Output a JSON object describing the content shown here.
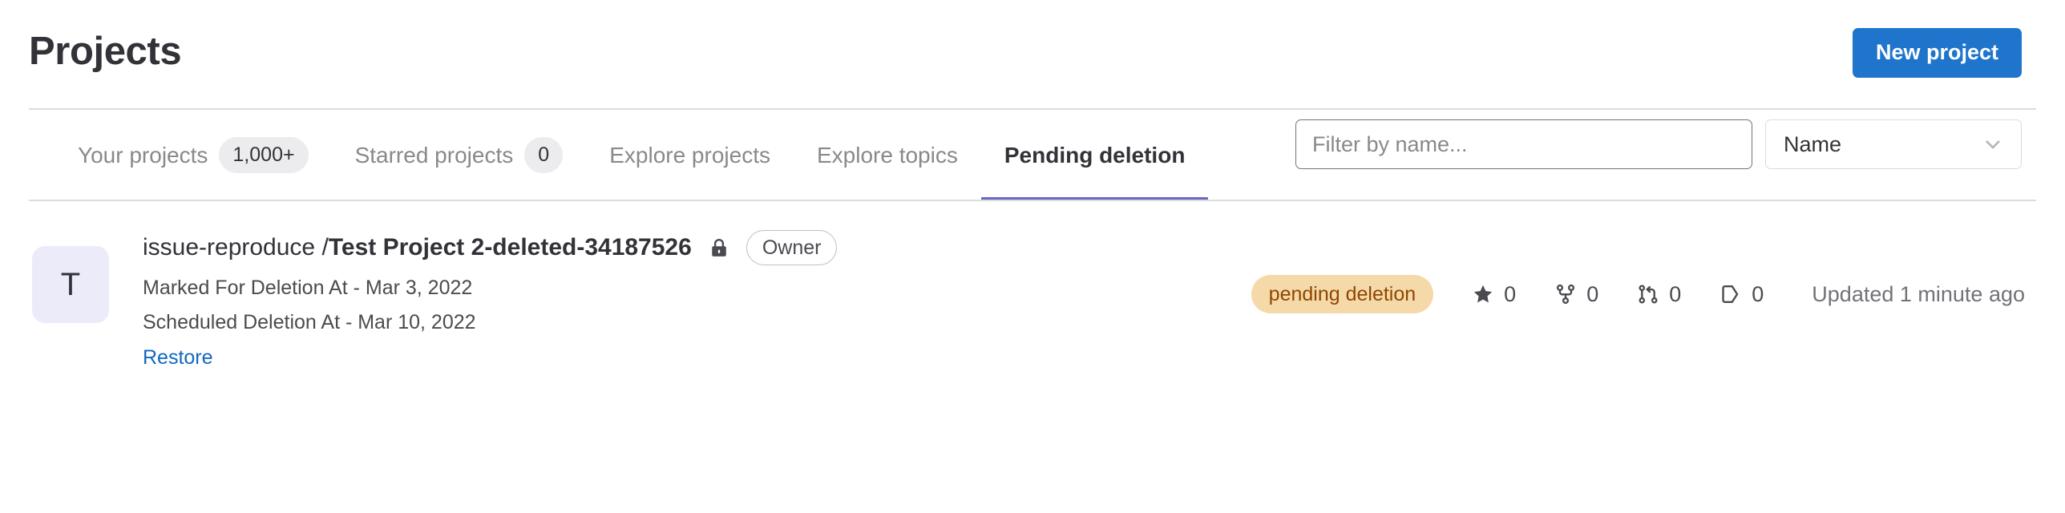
{
  "header": {
    "title": "Projects",
    "new_project_label": "New project"
  },
  "tabs": [
    {
      "label": "Your projects",
      "badge": "1,000+",
      "active": false
    },
    {
      "label": "Starred projects",
      "badge": "0",
      "active": false
    },
    {
      "label": "Explore projects",
      "badge": null,
      "active": false
    },
    {
      "label": "Explore topics",
      "badge": null,
      "active": false
    },
    {
      "label": "Pending deletion",
      "badge": null,
      "active": true
    }
  ],
  "filter": {
    "placeholder": "Filter by name...",
    "value": "",
    "sort_selected": "Name",
    "chevron_icon": "chevron-down-icon"
  },
  "project": {
    "avatar_initial": "T",
    "namespace": "issue-reproduce / ",
    "name": "Test Project 2-deleted-34187526",
    "visibility_icon": "lock-icon",
    "role_badge": "Owner",
    "marked_for_deletion": "Marked For Deletion At - Mar 3, 2022",
    "scheduled_deletion": "Scheduled Deletion At - Mar 10, 2022",
    "restore_label": "Restore",
    "status_badge": "pending deletion",
    "stats": [
      {
        "icon": "star-icon",
        "value": "0"
      },
      {
        "icon": "fork-icon",
        "value": "0"
      },
      {
        "icon": "merge-request-icon",
        "value": "0"
      },
      {
        "icon": "issues-icon",
        "value": "0"
      }
    ],
    "updated_text": "Updated 1 minute ago"
  },
  "colors": {
    "primary_button": "#1f75cb",
    "active_tab_underline": "#6666c4",
    "link": "#1068bf",
    "pending_badge_bg": "#f5d9a8",
    "pending_badge_text": "#8f4700",
    "avatar_bg": "#ebebfa"
  }
}
